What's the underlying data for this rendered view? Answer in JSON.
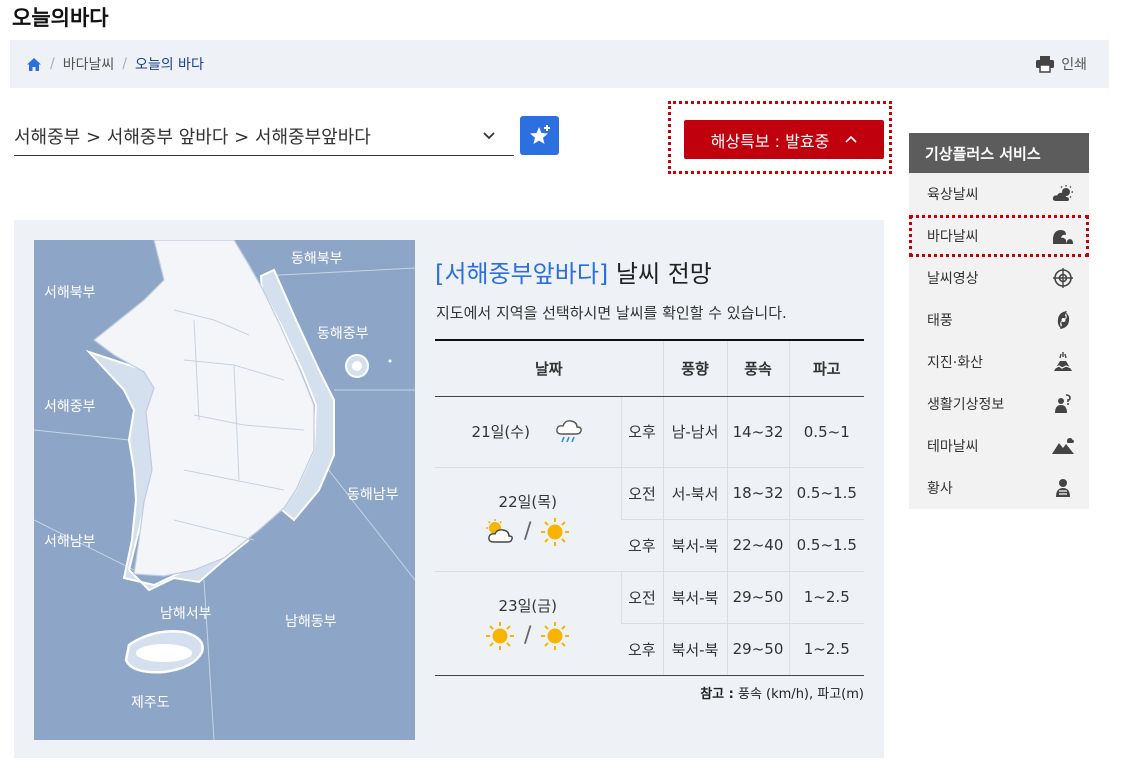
{
  "page": {
    "title": "오늘의바다"
  },
  "breadcrumb": {
    "home_icon": "home-icon",
    "sep": "/",
    "level1": "바다날씨",
    "level2": "오늘의 바다"
  },
  "toolbar": {
    "print_label": "인쇄",
    "print_icon": "printer-icon"
  },
  "region": {
    "selected": "서해중부 > 서해중부 앞바다 > 서해중부앞바다",
    "favorite_icon": "star-plus-icon"
  },
  "alert": {
    "label": "해상특보 : 발효중",
    "caret": "^",
    "color": "#c1000e"
  },
  "map": {
    "labels": [
      "동해북부",
      "서해북부",
      "동해중부",
      "서해중부",
      "동해남부",
      "서해남부",
      "남해서부",
      "남해동부",
      "제주도"
    ],
    "colors": {
      "sea": "#8da6c8",
      "land": "#f3f5f8",
      "zone": "#d4e0ee"
    }
  },
  "forecast": {
    "title_area": "[서해중부앞바다]",
    "title_rest": " 날씨 전망",
    "description": "지도에서 지역을 선택하시면 날씨를 확인할 수 있습니다.",
    "headers": {
      "date": "날짜",
      "wind_dir": "풍향",
      "wind_speed": "풍속",
      "wave": "파고"
    },
    "days": [
      {
        "label": "21일(수)",
        "icons": [
          "rain-cloud-icon"
        ],
        "rows": [
          {
            "period": "오후",
            "dir": "남-남서",
            "speed": "14~32",
            "wave": "0.5~1"
          }
        ]
      },
      {
        "label": "22일(목)",
        "icons": [
          "partly-cloudy-icon",
          "sun-icon"
        ],
        "rows": [
          {
            "period": "오전",
            "dir": "서-북서",
            "speed": "18~32",
            "wave": "0.5~1.5"
          },
          {
            "period": "오후",
            "dir": "북서-북",
            "speed": "22~40",
            "wave": "0.5~1.5"
          }
        ]
      },
      {
        "label": "23일(금)",
        "icons": [
          "sun-icon",
          "sun-icon"
        ],
        "rows": [
          {
            "period": "오전",
            "dir": "북서-북",
            "speed": "29~50",
            "wave": "1~2.5"
          },
          {
            "period": "오후",
            "dir": "북서-북",
            "speed": "29~50",
            "wave": "1~2.5"
          }
        ]
      }
    ],
    "slash": "/",
    "note_label": "참고 :",
    "note_text": " 풍속 (km/h), 파고(m)"
  },
  "sidebar": {
    "title": "기상플러스 서비스",
    "items": [
      {
        "label": "육상날씨",
        "icon": "land-weather-icon"
      },
      {
        "label": "바다날씨",
        "icon": "wave-icon",
        "active": true
      },
      {
        "label": "날씨영상",
        "icon": "radar-target-icon"
      },
      {
        "label": "태풍",
        "icon": "typhoon-icon"
      },
      {
        "label": "지진·화산",
        "icon": "volcano-icon"
      },
      {
        "label": "생활기상정보",
        "icon": "life-info-icon"
      },
      {
        "label": "테마날씨",
        "icon": "mountain-icon"
      },
      {
        "label": "황사",
        "icon": "dust-icon"
      }
    ]
  }
}
